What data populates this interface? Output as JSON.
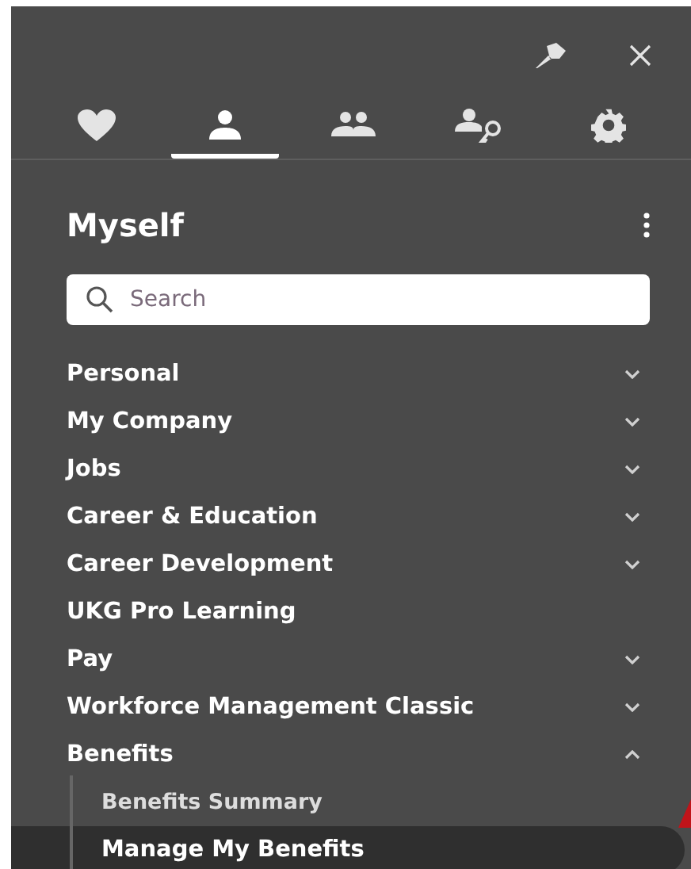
{
  "tabs": [
    {
      "kind": "favorites",
      "selected": false
    },
    {
      "kind": "myself",
      "selected": true
    },
    {
      "kind": "team",
      "selected": false
    },
    {
      "kind": "access",
      "selected": false
    },
    {
      "kind": "settings",
      "selected": false
    }
  ],
  "panel": {
    "title": "Myself"
  },
  "search": {
    "placeholder": "Search"
  },
  "menu": [
    {
      "label": "Personal",
      "kind": "group",
      "expanded": false
    },
    {
      "label": "My Company",
      "kind": "group",
      "expanded": false
    },
    {
      "label": "Jobs",
      "kind": "group",
      "expanded": false
    },
    {
      "label": "Career & Education",
      "kind": "group",
      "expanded": false
    },
    {
      "label": "Career Development",
      "kind": "group",
      "expanded": false
    },
    {
      "label": "UKG Pro Learning",
      "kind": "link"
    },
    {
      "label": "Pay",
      "kind": "group",
      "expanded": false
    },
    {
      "label": "Workforce Management Classic",
      "kind": "group",
      "expanded": false
    },
    {
      "label": "Benefits",
      "kind": "group",
      "expanded": true,
      "children": [
        {
          "label": "Benefits Summary",
          "selected": false
        },
        {
          "label": "Manage My Benefits",
          "selected": true
        }
      ]
    }
  ]
}
